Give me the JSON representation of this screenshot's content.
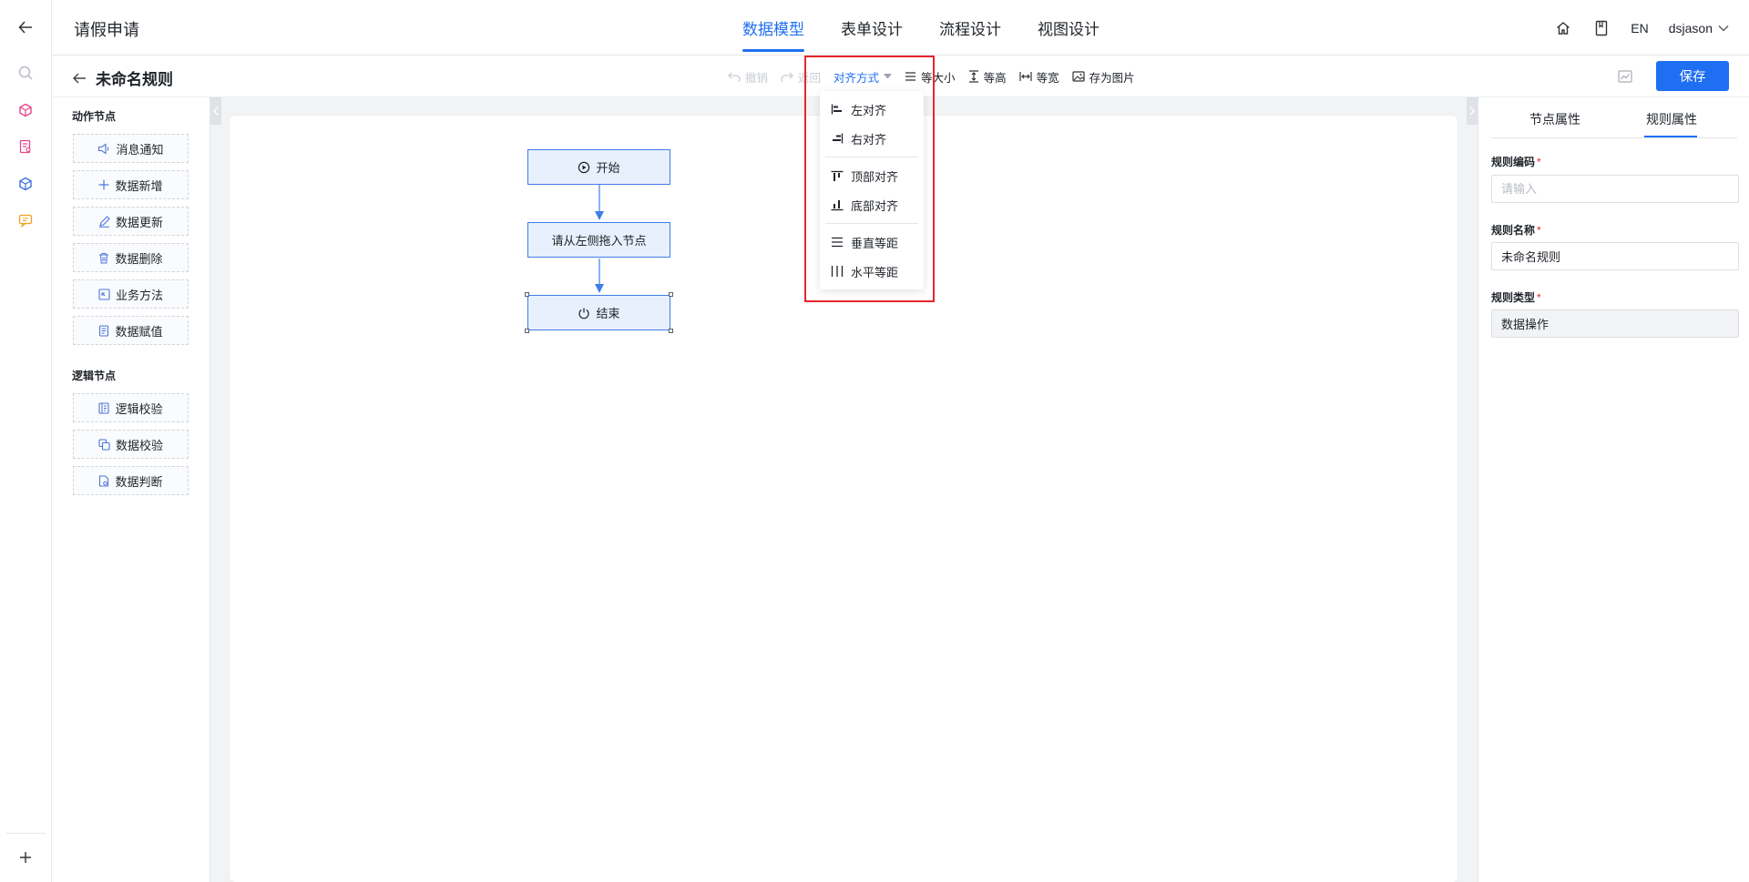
{
  "app": {
    "title": "请假申请"
  },
  "header": {
    "tabs": [
      {
        "label": "数据模型",
        "active": true
      },
      {
        "label": "表单设计",
        "active": false
      },
      {
        "label": "流程设计",
        "active": false
      },
      {
        "label": "视图设计",
        "active": false
      }
    ],
    "lang": "EN",
    "user": "dsjason"
  },
  "toolbar": {
    "title": "未命名规则",
    "undo": "撤销",
    "redo": "返回",
    "align": "对齐方式",
    "same_size": "等大小",
    "same_height": "等高",
    "same_width": "等宽",
    "save_image": "存为图片",
    "save": "保存"
  },
  "palette": {
    "action_title": "动作节点",
    "action_items": [
      "消息通知",
      "数据新增",
      "数据更新",
      "数据删除",
      "业务方法",
      "数据赋值"
    ],
    "logic_title": "逻辑节点",
    "logic_items": [
      "逻辑校验",
      "数据校验",
      "数据判断"
    ]
  },
  "flow": {
    "start": "开始",
    "placeholder": "请从左侧拖入节点",
    "end": "结束"
  },
  "align_menu": {
    "items": [
      "左对齐",
      "右对齐",
      "顶部对齐",
      "底部对齐",
      "垂直等距",
      "水平等距"
    ]
  },
  "right_panel": {
    "tabs": [
      "节点属性",
      "规则属性"
    ],
    "active_tab": "规则属性",
    "fields": {
      "code_label": "规则编码",
      "code_placeholder": "请输入",
      "code_value": "",
      "name_label": "规则名称",
      "name_value": "未命名规则",
      "type_label": "规则类型",
      "type_value": "数据操作"
    }
  },
  "colors": {
    "accent": "#1e6ff1",
    "highlight": "#e7262b",
    "node_fill": "#e7f0fc"
  }
}
